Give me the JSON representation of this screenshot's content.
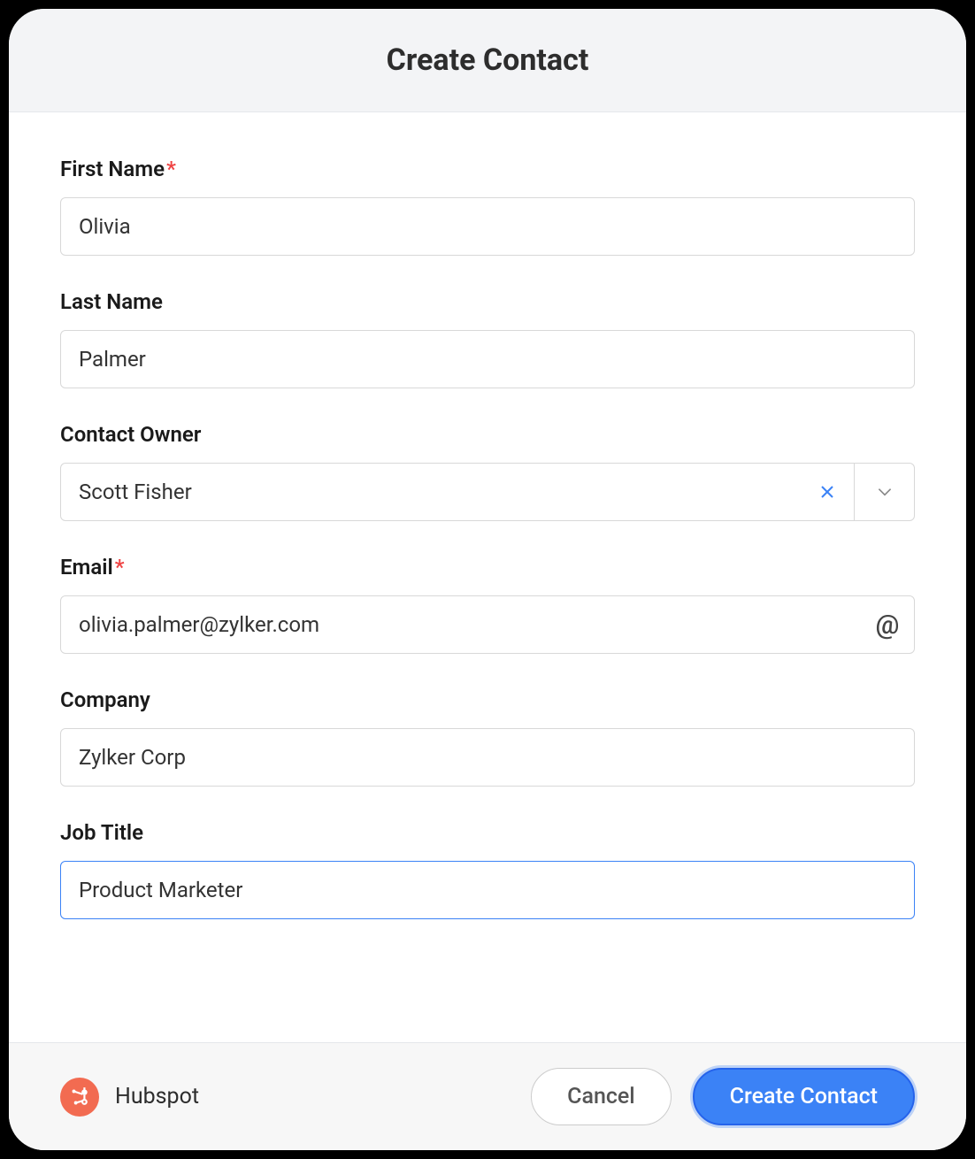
{
  "header": {
    "title": "Create Contact"
  },
  "form": {
    "first_name": {
      "label": "First Name",
      "required": "*",
      "value": "Olivia"
    },
    "last_name": {
      "label": "Last Name",
      "value": "Palmer"
    },
    "contact_owner": {
      "label": "Contact Owner",
      "value": "Scott Fisher"
    },
    "email": {
      "label": "Email",
      "required": "*",
      "value": "olivia.palmer@zylker.com",
      "at_symbol": "@"
    },
    "company": {
      "label": "Company",
      "value": "Zylker Corp"
    },
    "job_title": {
      "label": "Job Title",
      "value": "Product Marketer"
    }
  },
  "footer": {
    "integration_name": "Hubspot",
    "cancel_label": "Cancel",
    "submit_label": "Create Contact"
  }
}
